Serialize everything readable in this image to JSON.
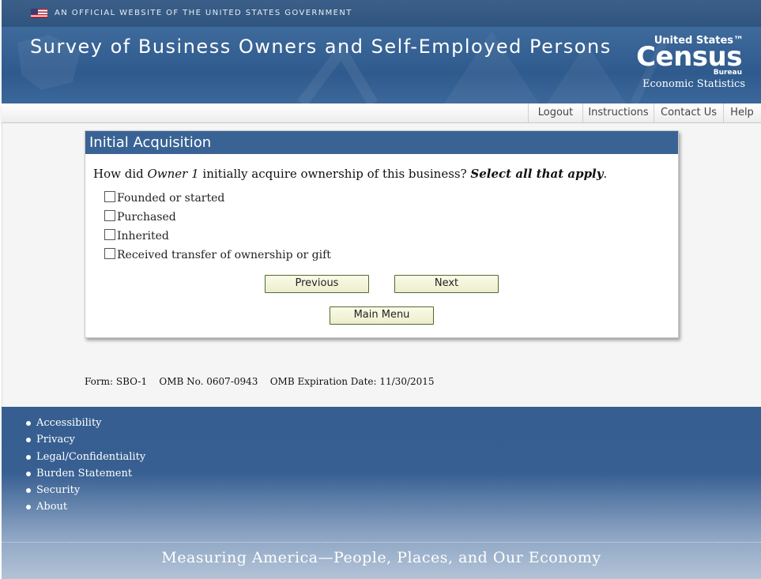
{
  "gov_banner": {
    "text": "AN OFFICIAL WEBSITE OF THE UNITED STATES GOVERNMENT",
    "flag_icon": "us-flag-icon"
  },
  "header": {
    "title": "Survey of Business Owners and Self-Employed Persons",
    "logo": {
      "line1": "United States™",
      "line2": "Census",
      "line3": "Bureau",
      "line4": "Economic Statistics"
    }
  },
  "nav": {
    "items": [
      "Logout",
      "Instructions",
      "Contact Us",
      "Help"
    ]
  },
  "panel": {
    "heading": "Initial Acquisition",
    "question": {
      "prefix": "How did ",
      "owner": "Owner 1",
      "middle": " initially acquire ownership of this business? ",
      "instruction": "Select all that apply",
      "suffix": "."
    },
    "options": [
      {
        "label": "Founded or started",
        "checked": false
      },
      {
        "label": "Purchased",
        "checked": false
      },
      {
        "label": "Inherited",
        "checked": false
      },
      {
        "label": "Received transfer of ownership or gift",
        "checked": false
      }
    ],
    "buttons": {
      "previous": "Previous",
      "next": "Next",
      "main_menu": "Main Menu"
    }
  },
  "form_info": {
    "form": "Form: SBO-1",
    "omb": "OMB No. 0607-0943",
    "expiration": "OMB Expiration Date: 11/30/2015"
  },
  "footer": {
    "links": [
      "Accessibility",
      "Privacy",
      "Legal/Confidentiality",
      "Burden Statement",
      "Security",
      "About"
    ],
    "tagline": "Measuring America—People, Places, and Our Economy"
  },
  "colors": {
    "header_blue": "#2f5a8d",
    "panel_head": "#3a6395",
    "button_border": "#4f6b2d"
  }
}
